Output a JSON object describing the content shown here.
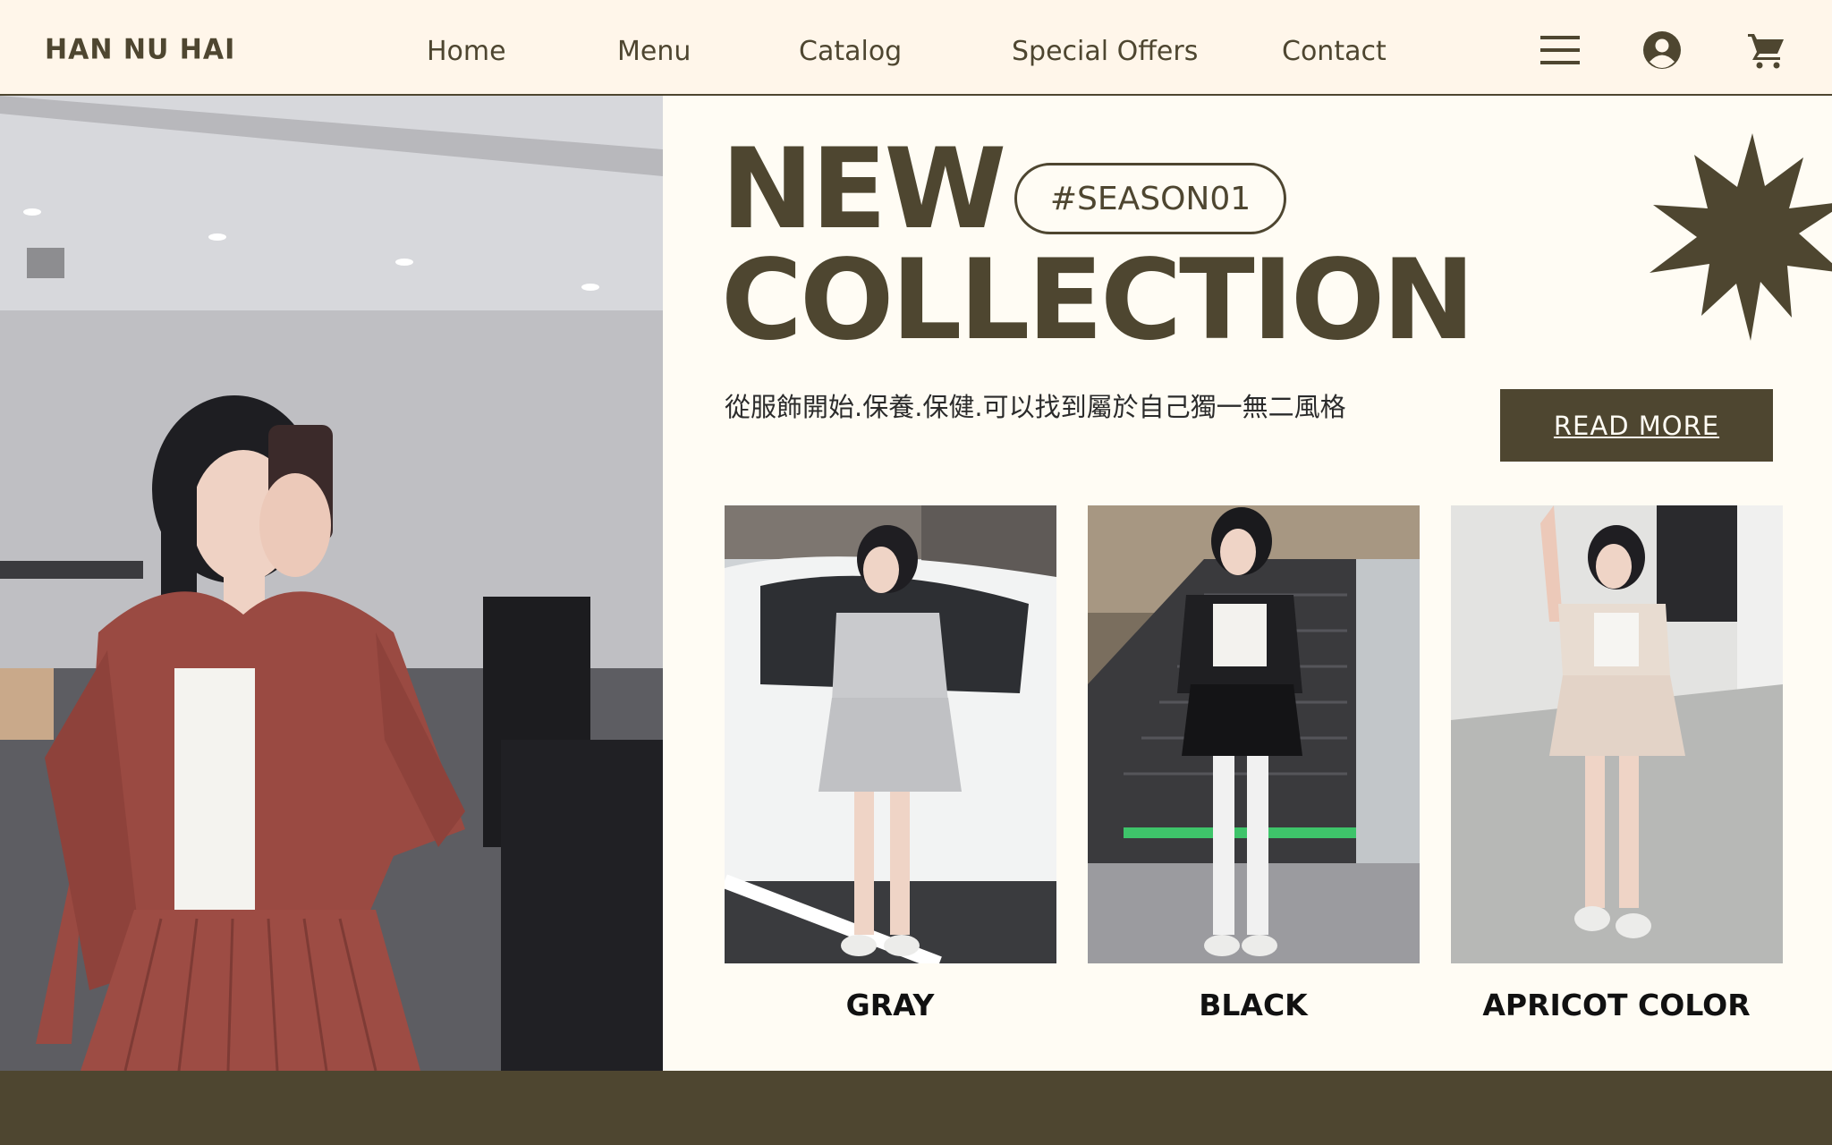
{
  "brand": {
    "logo": "HAN NU HAI"
  },
  "nav": {
    "links": [
      "Home",
      "Menu",
      "Catalog",
      "Special Offers",
      "Contact"
    ],
    "icons": [
      "hamburger-menu-icon",
      "user-account-icon",
      "shopping-cart-icon"
    ]
  },
  "hero": {
    "headline_line1": "NEW",
    "headline_line2": "COLLECTION",
    "season_tag": "#SEASON01",
    "subtitle": "從服飾開始.保養.保健.可以找到屬於自己獨一無二風格",
    "cta_label": "READ MORE"
  },
  "products": [
    {
      "label": "GRAY"
    },
    {
      "label": "BLACK"
    },
    {
      "label": "APRICOT COLOR"
    }
  ],
  "colors": {
    "accent": "#4e4630",
    "header_bg": "#fff6ea",
    "page_bg": "#fffcf4",
    "suit_red": "#9a4a42",
    "suit_gray": "#c9cacd",
    "suit_black": "#1f1f22",
    "suit_apricot": "#e8dcd1"
  }
}
